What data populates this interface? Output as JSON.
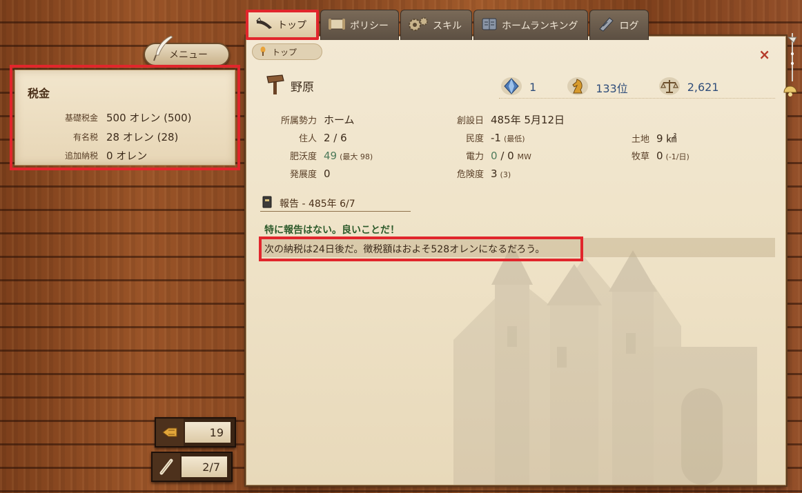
{
  "menu": {
    "label": "メニュー"
  },
  "tax": {
    "title": "税金",
    "rows": [
      {
        "label": "基礎税金",
        "value": "500 オレン (500)"
      },
      {
        "label": "有名税",
        "value": "28 オレン (28)"
      },
      {
        "label": "追加納税",
        "value": "0 オレン"
      }
    ]
  },
  "counters": {
    "tickets": "19",
    "scrolls": "2/7"
  },
  "tabs": [
    {
      "label": "トップ",
      "icon": "quill-icon"
    },
    {
      "label": "ポリシー",
      "icon": "scroll-icon"
    },
    {
      "label": "スキル",
      "icon": "gears-icon"
    },
    {
      "label": "ホームランキング",
      "icon": "book-icon"
    },
    {
      "label": "ログ",
      "icon": "log-icon"
    }
  ],
  "panel": {
    "breadcrumb": "トップ",
    "close": "×",
    "place_name": "野原",
    "stats": {
      "crystal": "1",
      "rank": "133位",
      "balance": "2,621"
    },
    "fields": {
      "faction_label": "所属勢力",
      "faction_value": "ホーム",
      "founded_label": "創設日",
      "founded_value": "485年 5月12日",
      "residents_label": "住人",
      "residents_value": "2 / 6",
      "morale_label": "民度",
      "morale_value": "-1",
      "morale_note": "(最低)",
      "land_label": "土地",
      "land_value": "9 ㎢",
      "fertility_label": "肥沃度",
      "fertility_value": "49",
      "fertility_note": "(最大 98)",
      "power_label": "電力",
      "power_value_a": "0",
      "power_value_b": " / 0 ",
      "power_unit": "MW",
      "pasture_label": "牧草",
      "pasture_value": "0",
      "pasture_note": "(-1/日)",
      "development_label": "発展度",
      "development_value": "0",
      "danger_label": "危険度",
      "danger_value": "3",
      "danger_note": "(3)"
    },
    "report": {
      "title": "報告 - 485年 6/7",
      "message_good": "特に報告はない。良いことだ！",
      "message_tax": "次の納税は24日後だ。徴税額はおよそ528オレンになるだろう。"
    }
  },
  "colors": {
    "highlight": "#e1262c",
    "wood": "#8a4a22",
    "parchment": "#f3e9d4"
  }
}
